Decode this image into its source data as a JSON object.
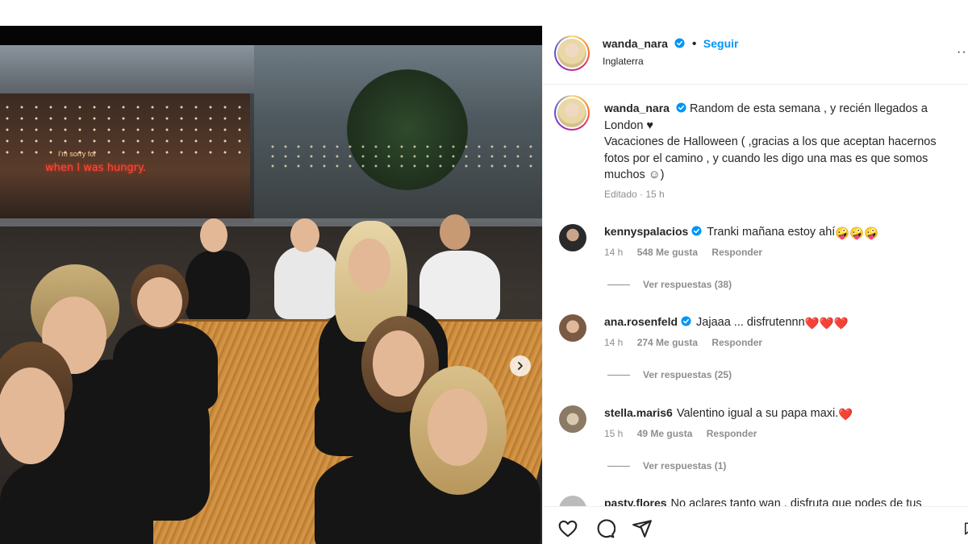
{
  "post": {
    "username": "wanda_nara",
    "follow_label": "Seguir",
    "location": "Inglaterra",
    "more_label": "···",
    "caption_line": "Random de esta semana , y recién llegados a London ♥",
    "caption_line2": "Vacaciones de Halloween ( ,gracias a los que aceptan hacernos fotos por el camino , y cuando les digo una mas es que somos muchos ☺)",
    "edited": "Editado",
    "caption_time": "15 h"
  },
  "photo": {
    "neon_top": "I'm sorry for",
    "neon_main": "when I was hungry."
  },
  "comments": [
    {
      "username": "kennyspalacios",
      "verified": true,
      "text": "Tranki mañana estoy ahí",
      "emojis": "🤪🤪🤪",
      "time": "14 h",
      "likes": "548 Me gusta",
      "reply": "Responder",
      "view_replies": "Ver respuestas (38)"
    },
    {
      "username": "ana.rosenfeld",
      "verified": true,
      "text": "Jajaaa ... disfrutennn",
      "emojis": "❤️❤️❤️",
      "time": "14 h",
      "likes": "274 Me gusta",
      "reply": "Responder",
      "view_replies": "Ver respuestas (25)"
    },
    {
      "username": "stella.maris6",
      "verified": false,
      "text": "Valentino igual a su papa maxi.",
      "emojis": "❤️",
      "time": "15 h",
      "likes": "49 Me gusta",
      "reply": "Responder",
      "view_replies": "Ver respuestas (1)"
    },
    {
      "username": "pasty.flores",
      "verified": false,
      "text": "No aclares tanto wan , disfruta que podes de tus",
      "emojis": "",
      "time": "",
      "likes": "",
      "reply": "",
      "view_replies": ""
    }
  ],
  "icons": {
    "like": "heart-icon",
    "comment": "comment-icon",
    "share": "share-icon",
    "save": "bookmark-icon",
    "verified": "verified-badge-icon",
    "next": "chevron-right-icon"
  },
  "colors": {
    "link": "#0095f6",
    "muted": "#8e8e8e",
    "text": "#262626",
    "verified": "#0095f6",
    "heart": "#ed4956"
  }
}
